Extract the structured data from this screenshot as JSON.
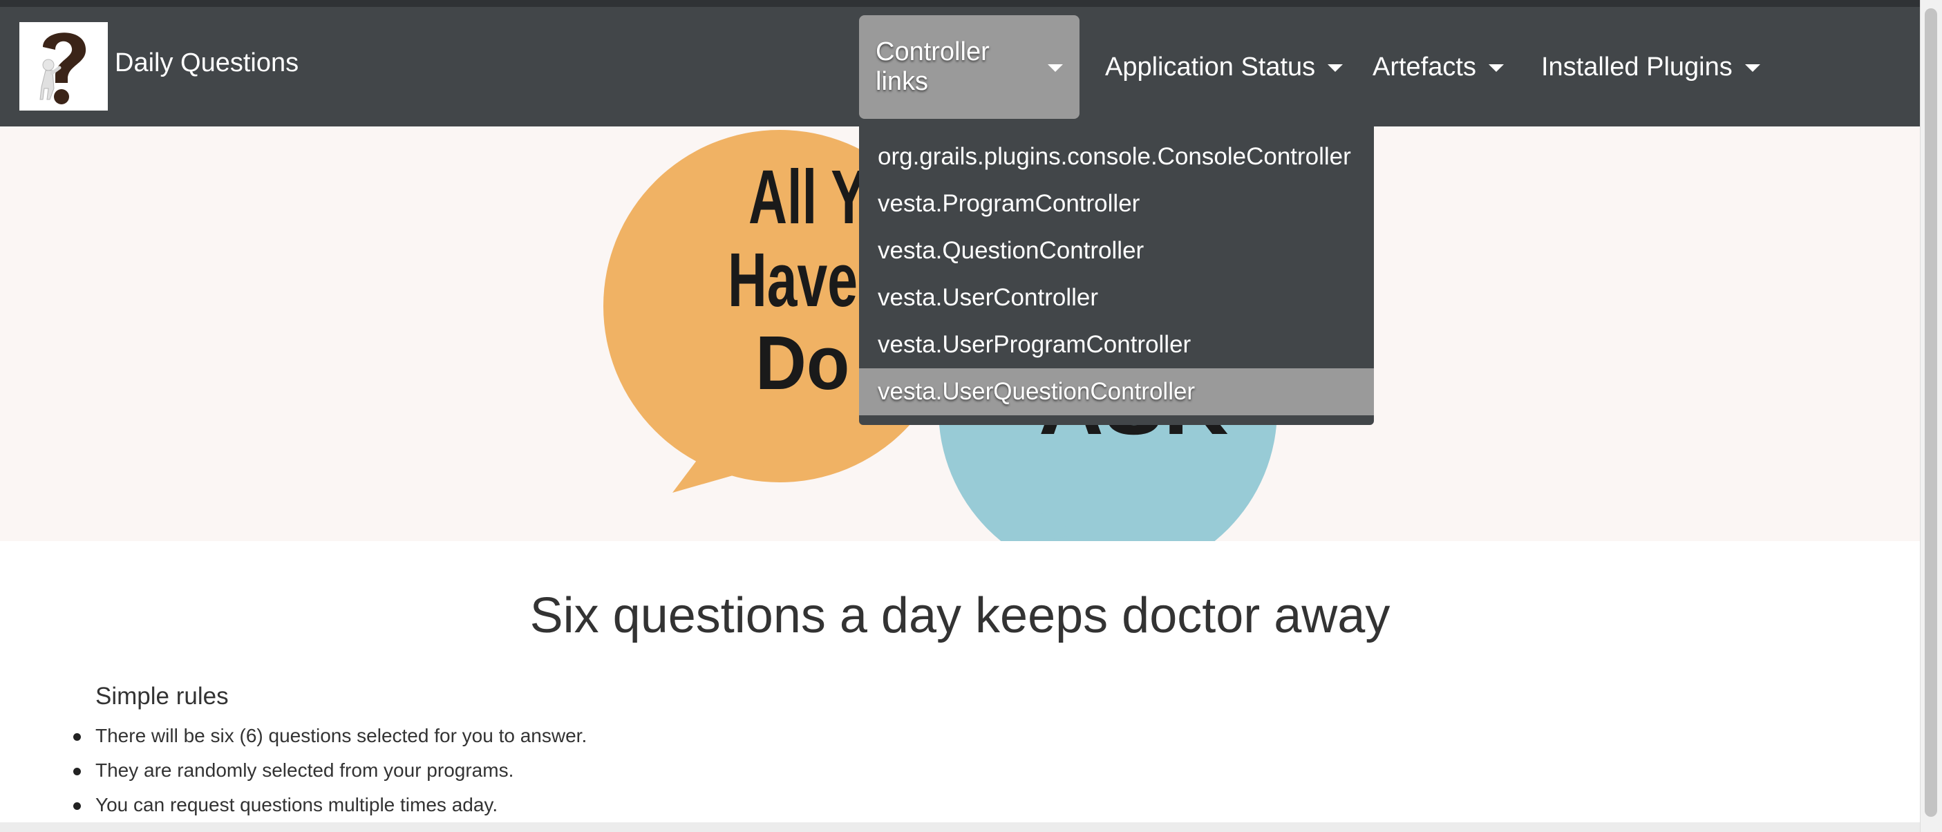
{
  "brand": {
    "name": "Daily Questions",
    "logo_icon": "question-mark-figure-icon"
  },
  "nav": {
    "items": [
      {
        "label": "Controller links",
        "active": true
      },
      {
        "label": "Application Status"
      },
      {
        "label": "Artefacts"
      },
      {
        "label": "Installed Plugins"
      }
    ]
  },
  "dropdown": {
    "items": [
      {
        "label": "org.grails.plugins.console.ConsoleController"
      },
      {
        "label": "vesta.ProgramController"
      },
      {
        "label": "vesta.QuestionController"
      },
      {
        "label": "vesta.UserController"
      },
      {
        "label": "vesta.UserProgramController"
      },
      {
        "label": "vesta.UserQuestionController",
        "hover": true
      }
    ]
  },
  "hero": {
    "bubble_left_text": "All You Have To Do Is",
    "bubble_right_text": "ASK"
  },
  "main": {
    "headline": "Six questions a day keeps doctor away",
    "rules_title": "Simple rules",
    "rules": [
      "There will be six (6) questions selected for you to answer.",
      "They are randomly selected from your programs.",
      "You can request questions multiple times aday."
    ]
  },
  "colors": {
    "navbar": "#424649",
    "active_item": "#9a9a9a",
    "hero_background": "#fbf6f4",
    "bubble_orange": "#f0b264",
    "bubble_blue": "#98cbd6"
  }
}
